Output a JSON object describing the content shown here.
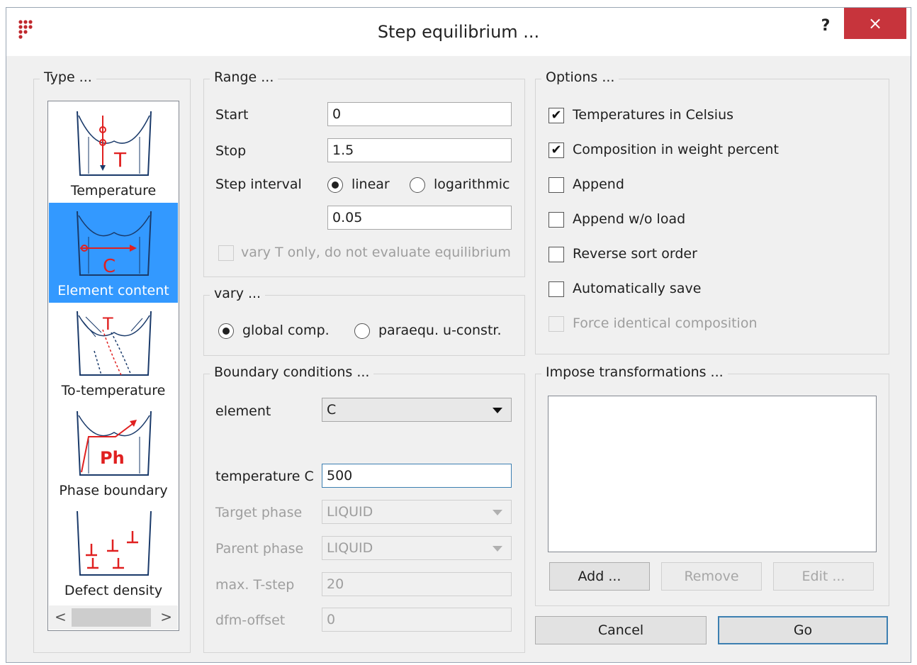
{
  "window": {
    "title": "Step equilibrium ...",
    "help_label": "?",
    "close_label": "×"
  },
  "type_group": {
    "legend": "Type ...",
    "items": [
      {
        "label": "Temperature",
        "icon": "temperature-step-icon",
        "selected": false
      },
      {
        "label": "Element content",
        "icon": "element-content-step-icon",
        "selected": true
      },
      {
        "label": "To-temperature",
        "icon": "to-temperature-step-icon",
        "selected": false
      },
      {
        "label": "Phase boundary",
        "icon": "phase-boundary-step-icon",
        "selected": false
      },
      {
        "label": "Defect density",
        "icon": "defect-density-step-icon",
        "selected": false
      }
    ],
    "scroll_left": "<",
    "scroll_right": ">"
  },
  "range": {
    "legend": "Range ...",
    "start_label": "Start",
    "start_value": "0",
    "stop_label": "Stop",
    "stop_value": "1.5",
    "interval_label": "Step interval",
    "linear_label": "linear",
    "log_label": "logarithmic",
    "interval_mode": "linear",
    "interval_value": "0.05",
    "vary_t_label": "vary T only, do not evaluate equilibrium"
  },
  "vary": {
    "legend": "vary ...",
    "global_label": "global comp.",
    "paraequ_label": "paraequ. u-constr.",
    "selected": "global comp."
  },
  "boundary": {
    "legend": "Boundary conditions ...",
    "element_label": "element",
    "element_value": "C",
    "temperature_label": "temperature C",
    "temperature_value": "500",
    "target_label": "Target phase",
    "target_value": "LIQUID",
    "parent_label": "Parent phase",
    "parent_value": "LIQUID",
    "maxt_label": "max. T-step",
    "maxt_value": "20",
    "dfm_label": "dfm-offset",
    "dfm_value": "0"
  },
  "options": {
    "legend": "Options ...",
    "items": [
      {
        "label": "Temperatures in Celsius",
        "checked": true,
        "enabled": true
      },
      {
        "label": "Composition in weight percent",
        "checked": true,
        "enabled": true
      },
      {
        "label": "Append",
        "checked": false,
        "enabled": true
      },
      {
        "label": "Append w/o load",
        "checked": false,
        "enabled": true
      },
      {
        "label": "Reverse sort order",
        "checked": false,
        "enabled": true
      },
      {
        "label": "Automatically save",
        "checked": false,
        "enabled": true
      },
      {
        "label": "Force identical composition",
        "checked": false,
        "enabled": false
      }
    ],
    "check_mark": "✔"
  },
  "transformations": {
    "legend": "Impose transformations ...",
    "add_label": "Add ...",
    "remove_label": "Remove",
    "edit_label": "Edit ..."
  },
  "footer": {
    "cancel_label": "Cancel",
    "go_label": "Go"
  },
  "colors": {
    "selection": "#3399ff",
    "close_button": "#c7343c",
    "icon_red": "#e02020"
  }
}
